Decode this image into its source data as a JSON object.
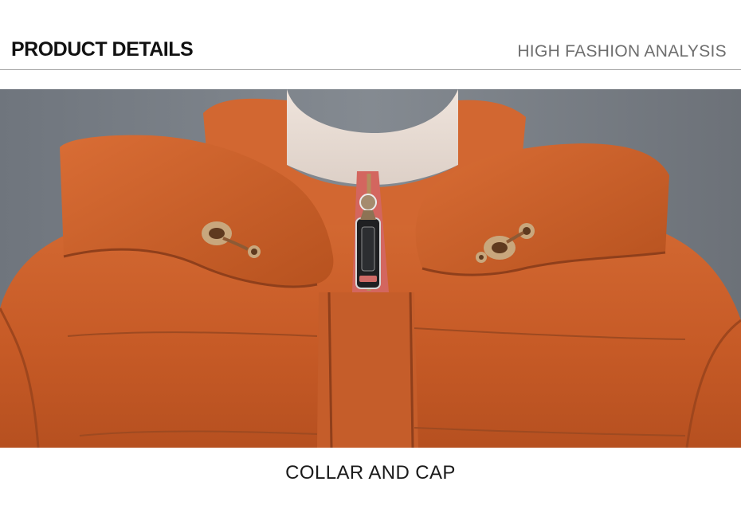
{
  "header": {
    "left_title": "PRODUCT DETAILS",
    "right_title": "HIGH FASHION ANALYSIS"
  },
  "photo": {
    "subject": "jacket-collar-and-hood"
  },
  "caption": {
    "text": "COLLAR AND CAP"
  },
  "colors": {
    "background": "#7a7f86",
    "jacket": "#c85e2a",
    "jacket_shadow": "#9e461d",
    "jacket_highlight": "#e07a43",
    "zipper_tape": "#d25f58",
    "skin": "#e8dcd4",
    "hardware": "#c8a77d"
  },
  "icons": {
    "left_grommet": "grommet-icon",
    "right_grommet": "grommet-icon",
    "zipper": "zipper-pull-icon"
  }
}
